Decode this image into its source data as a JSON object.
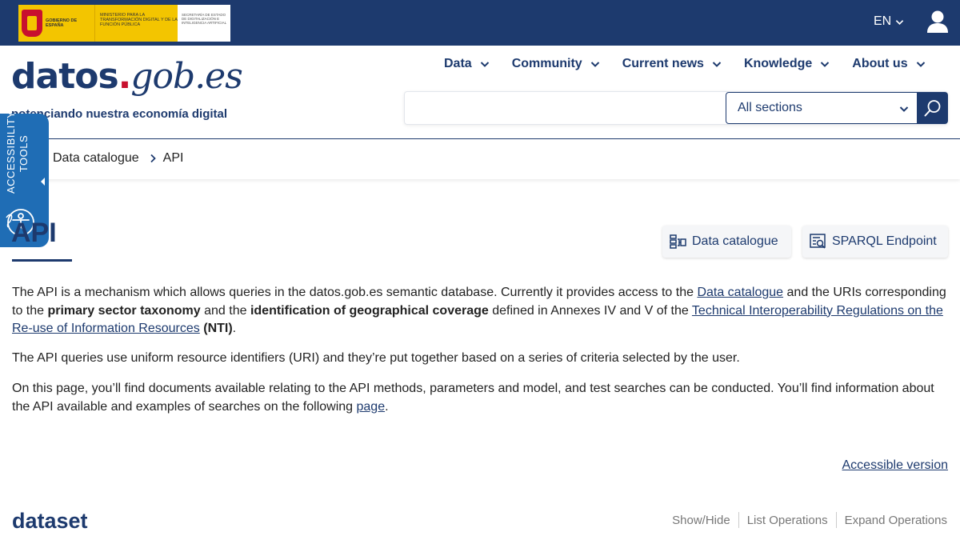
{
  "topbar": {
    "gov_logo_text": "GOBIERNO DE ESPAÑA",
    "ministry_text": "MINISTERIO PARA LA TRANSFORMACIÓN DIGITAL Y DE LA FUNCIÓN PÚBLICA",
    "secretaria_text": "SECRETARÍA DE ESTADO DE DIGITALIZACIÓN E INTELIGENCIA ARTIFICIAL",
    "language": "EN"
  },
  "header": {
    "brand_main": "datos",
    "brand_dot": ".",
    "brand_gob": "gob",
    "brand_es": ".es",
    "tagline": "potenciando nuestra economía digital"
  },
  "nav": {
    "items": [
      {
        "label": "Data"
      },
      {
        "label": "Community"
      },
      {
        "label": "Current news"
      },
      {
        "label": "Knowledge"
      },
      {
        "label": "About us"
      }
    ]
  },
  "search": {
    "placeholder": "",
    "section_selected": "All sections"
  },
  "breadcrumb": {
    "items": [
      "Data catalogue",
      "API"
    ]
  },
  "accessibility": {
    "label_line1": "ACCESSIBILITY",
    "label_line2": "TOOLS"
  },
  "page": {
    "title": "API",
    "btn_catalogue": "Data catalogue",
    "btn_sparql": "SPARQL Endpoint",
    "p1_a": "The API is a mechanism which allows queries in the datos.gob.es semantic database. Currently it provides access to the ",
    "p1_link1": "Data catalogue",
    "p1_b": " and the URIs corresponding to the ",
    "p1_bold1": "primary sector taxonomy",
    "p1_c": " and the ",
    "p1_bold2": "identification of geographical coverage",
    "p1_d": " defined in Annexes IV and V of the ",
    "p1_link2": "Technical Interoperability Regulations on the Re-use of Information Resources",
    "p1_e": " ",
    "p1_bold3": "(NTI)",
    "p1_f": ".",
    "p2": "The API queries use uniform resource identifiers (URI) and they’re put together based on a series of criteria selected by the user.",
    "p3_a": "On this page, you’ll find documents available relating to the API methods, parameters and model, and test searches can be conducted. You’ll find information about the API available and examples of searches on the following ",
    "p3_link": "page",
    "p3_b": ".",
    "accessible_version": "Accessible version",
    "section_title": "dataset",
    "ops_show_hide": "Show/Hide",
    "ops_list": "List Operations",
    "ops_expand": "Expand Operations"
  },
  "colors": {
    "brand_navy": "#1d3a6e",
    "accessibility_blue": "#1f6db5",
    "accent_red": "#c8102e",
    "gov_yellow": "#f3c500"
  }
}
